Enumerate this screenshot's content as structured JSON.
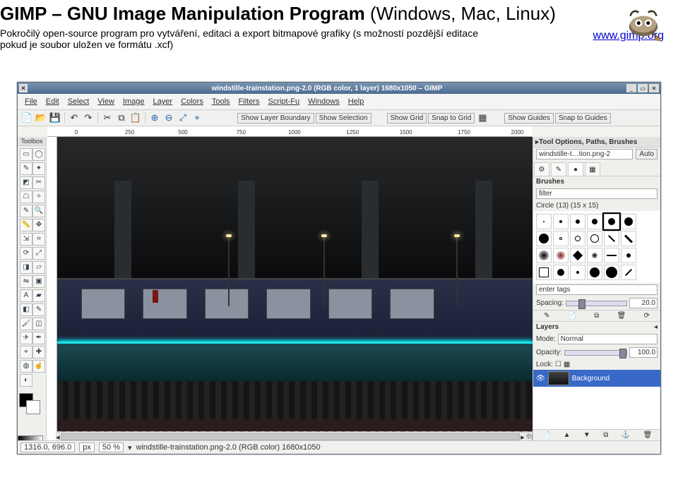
{
  "header": {
    "title_bold": "GIMP – GNU Image Manipulation Program",
    "title_rest": " (Windows, Mac, Linux)",
    "desc": "Pokročilý open-source program pro vytváření, editaci a export bitmapové grafiky (s možností pozdější editace pokud je soubor uložen ve formátu .xcf)",
    "link": "www.gimp.org"
  },
  "window": {
    "title": "windstille-trainstation.png-2.0 (RGB color, 1 layer) 1680x1050 – GIMP",
    "menus": [
      "File",
      "Edit",
      "Select",
      "View",
      "Image",
      "Layer",
      "Colors",
      "Tools",
      "Filters",
      "Script-Fu",
      "Windows",
      "Help"
    ],
    "toolbar_buttons": [
      "Show Layer Boundary",
      "Show Selection",
      "Show Grid",
      "Snap to Grid",
      "Show Guides",
      "Snap to Guides"
    ],
    "ruler_ticks": [
      "0",
      "250",
      "500",
      "750",
      "1000",
      "1250",
      "1500",
      "1750",
      "2000"
    ],
    "toolbox_title": "Toolbox"
  },
  "right": {
    "title": "Tool Options, Paths, Brushes",
    "image_sel": "windstille-t…tion.png-2",
    "auto": "Auto",
    "brushes": {
      "label": "Brushes",
      "filter": "filter",
      "current": "Circle (13) (15 x 15)",
      "tags": "enter tags",
      "spacing_label": "Spacing:",
      "spacing_value": "20.0"
    },
    "layers": {
      "label": "Layers",
      "mode_label": "Mode:",
      "mode_value": "Normal",
      "opacity_label": "Opacity:",
      "opacity_value": "100.0",
      "lock_label": "Lock:",
      "layer_name": "Background"
    }
  },
  "status": {
    "pos": "1316.0, 696.0",
    "unit": "px",
    "zoom": "50 %",
    "info": "windstille-trainstation.png-2.0 (RGB color) 1680x1050"
  }
}
